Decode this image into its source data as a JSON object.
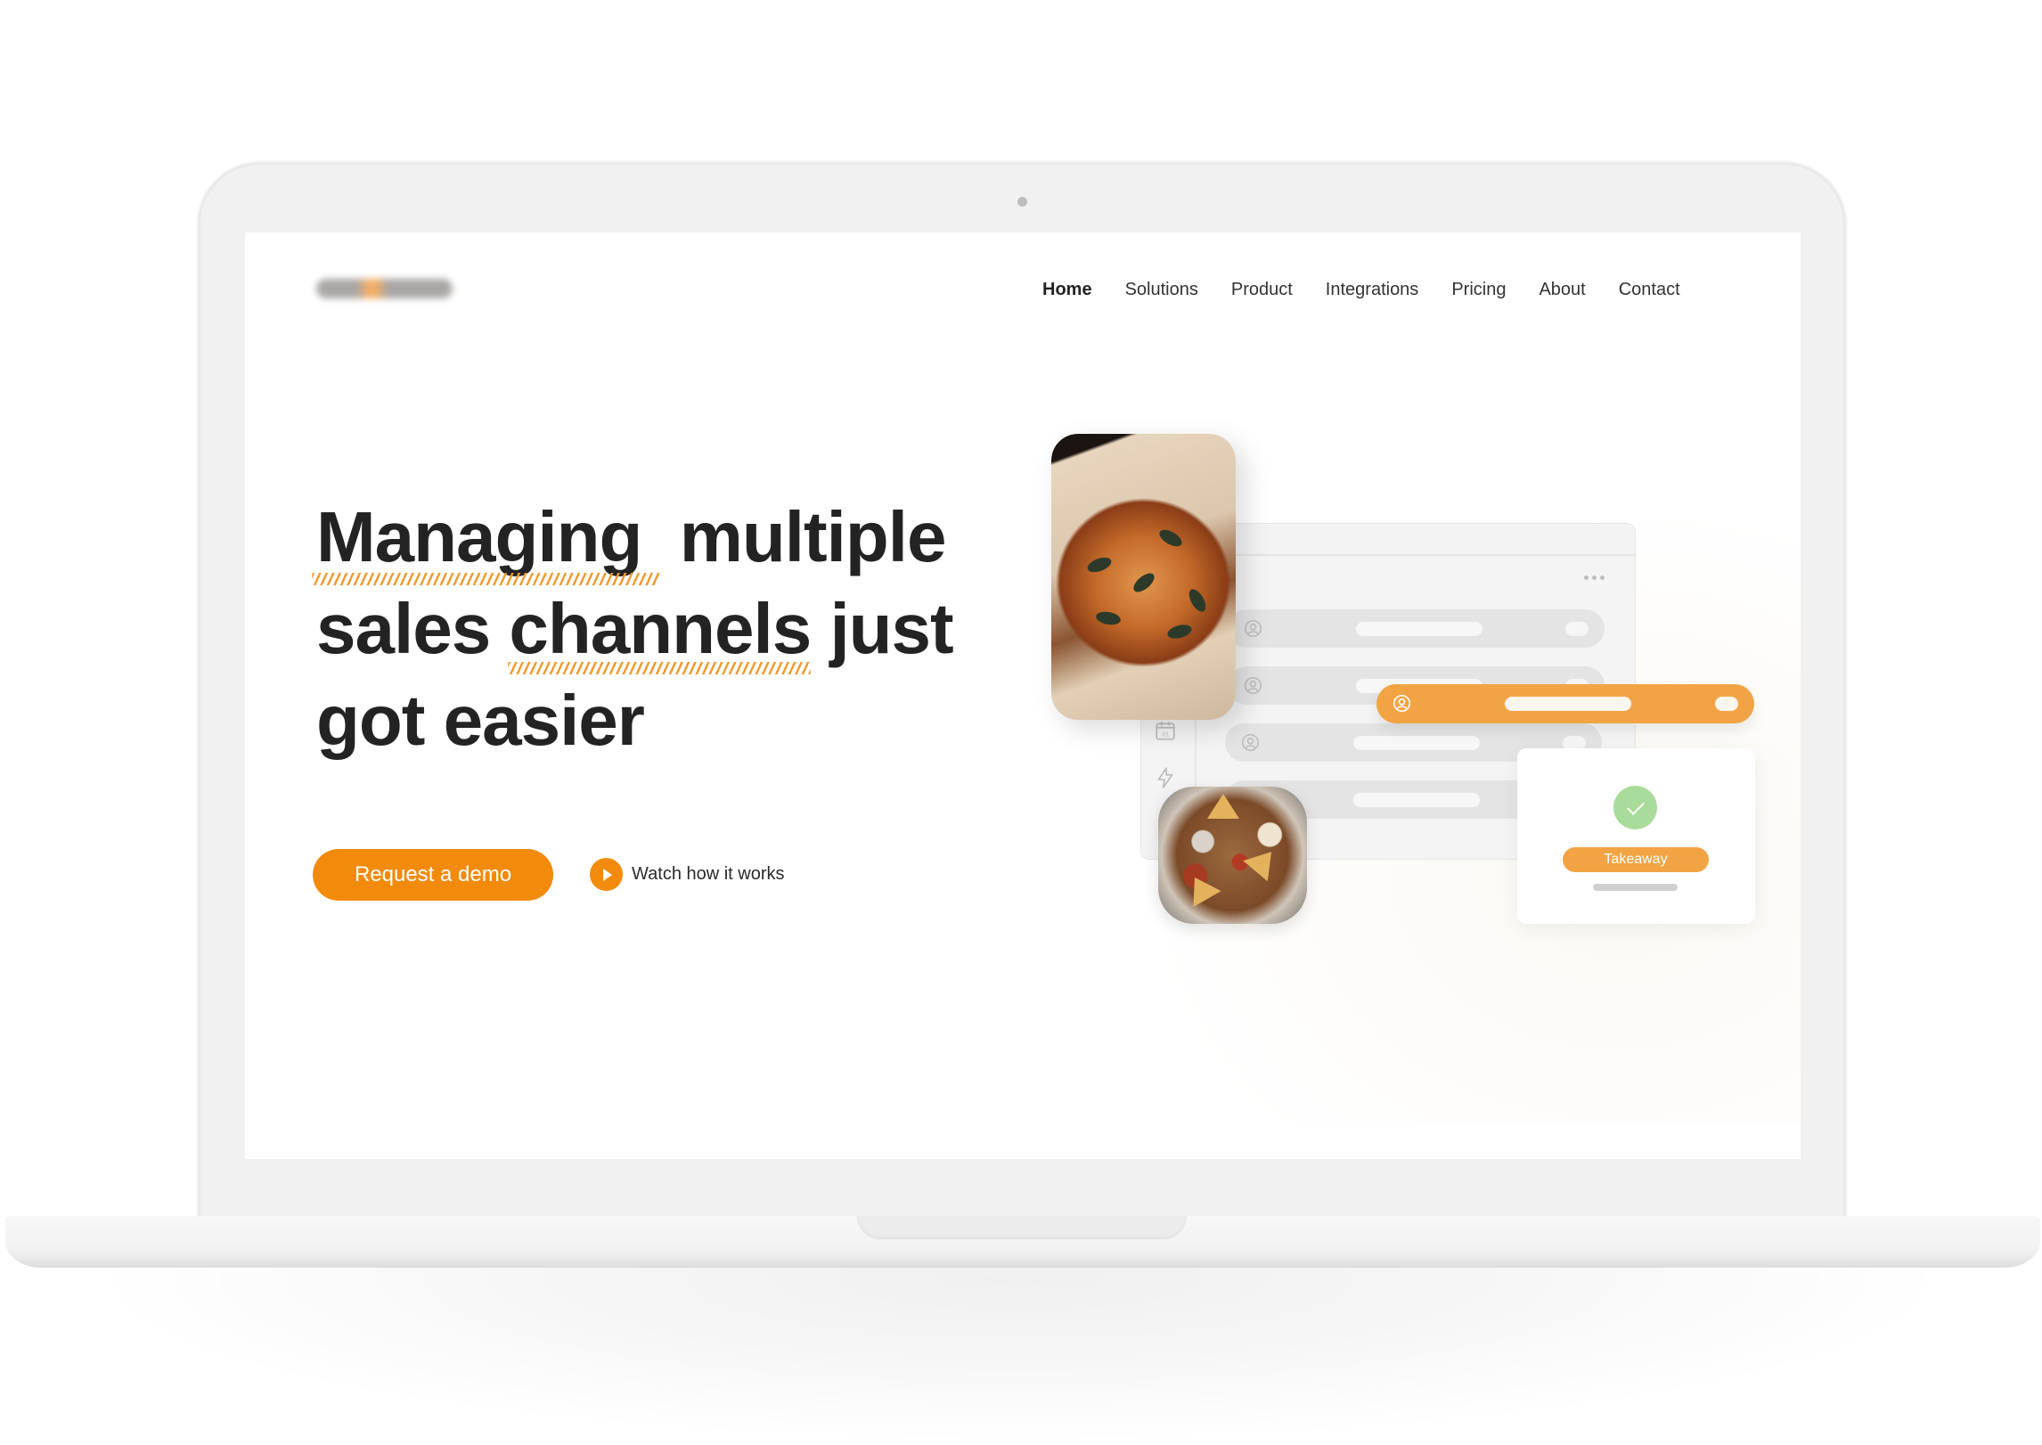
{
  "nav": {
    "logo": "brand-logo (blurred)",
    "items": [
      {
        "label": "Home",
        "active": true
      },
      {
        "label": "Solutions",
        "active": false
      },
      {
        "label": "Product",
        "active": false
      },
      {
        "label": "Integrations",
        "active": false
      },
      {
        "label": "Pricing",
        "active": false
      },
      {
        "label": "About",
        "active": false
      },
      {
        "label": "Contact",
        "active": false
      }
    ]
  },
  "hero": {
    "headline_lines": [
      "Managing  multiple",
      "sales channels just",
      "got easier"
    ],
    "highlighted_words": [
      "Managing",
      "channels"
    ],
    "primary_cta": "Request a demo",
    "secondary_cta": "Watch how it works"
  },
  "illustration": {
    "order_status_label": "Takeaway",
    "menu_dots_icon": "more-horizontal-icon",
    "row_icon": "user-circle-icon",
    "sidebar_icons": [
      "calendar-icon",
      "lightning-icon"
    ],
    "calendar_day": "31",
    "images": [
      "pizza-photo",
      "food-platter-photo"
    ]
  },
  "colors": {
    "accent": "#f28b0c",
    "accent_soft": "#f2a444",
    "success": "#a9dc9a",
    "text": "#232323"
  }
}
